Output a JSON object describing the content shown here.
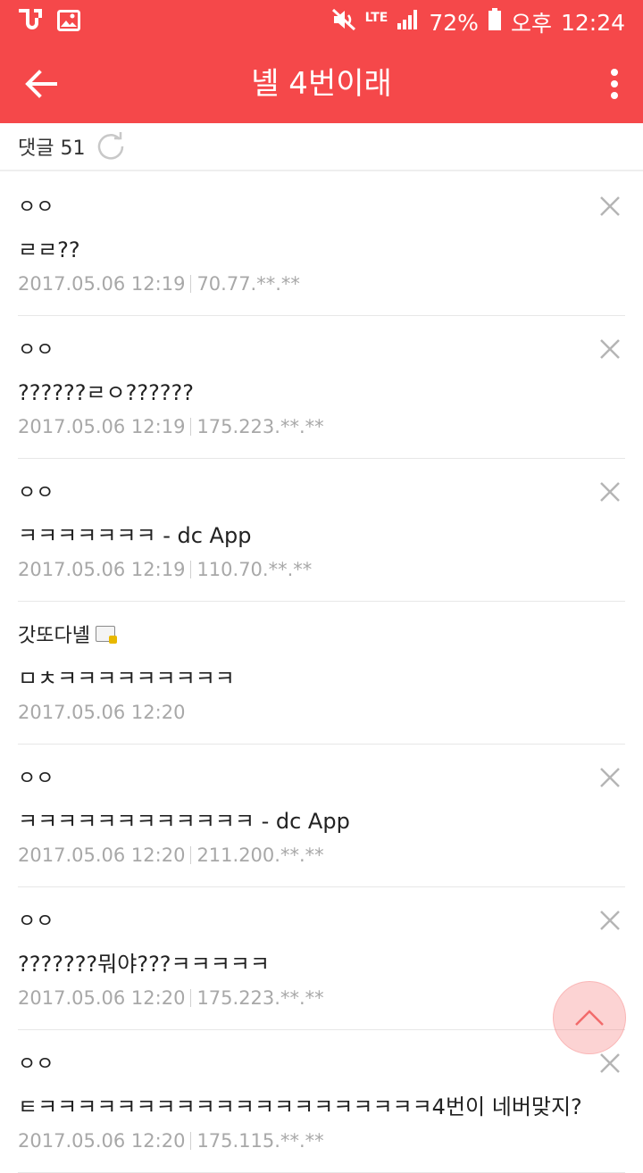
{
  "status_bar": {
    "battery": "72%",
    "ampm": "오후",
    "time": "12:24",
    "network": "LTE"
  },
  "app_bar": {
    "title": "녤 4번이래"
  },
  "comment_header": {
    "label": "댓글 51"
  },
  "comments": [
    {
      "author": "ㅇㅇ",
      "text": "ㄹㄹ??",
      "date": "2017.05.06 12:19",
      "ip": "70.77.**.**",
      "deletable": true
    },
    {
      "author": "ㅇㅇ",
      "text": "??????ㄹㅇ??????",
      "date": "2017.05.06 12:19",
      "ip": "175.223.**.**",
      "deletable": true
    },
    {
      "author": "ㅇㅇ",
      "text": "ㅋㅋㅋㅋㅋㅋㅋ - dc App",
      "date": "2017.05.06 12:19",
      "ip": "110.70.**.**",
      "deletable": true
    },
    {
      "author": "갓또다녤",
      "text": "ㅁㅊㅋㅋㅋㅋㅋㅋㅋㅋㅋ",
      "date": "2017.05.06 12:20",
      "ip": "",
      "deletable": false
    },
    {
      "author": "ㅇㅇ",
      "text": "ㅋㅋㅋㅋㅋㅋㅋㅋㅋㅋㅋㅋ - dc App",
      "date": "2017.05.06 12:20",
      "ip": "211.200.**.**",
      "deletable": true
    },
    {
      "author": "ㅇㅇ",
      "text": "???????뭐야???ㅋㅋㅋㅋㅋ",
      "date": "2017.05.06 12:20",
      "ip": "175.223.**.**",
      "deletable": true
    },
    {
      "author": "ㅇㅇ",
      "text": "ㅌㅋㅋㅋㅋㅋㅋㅋㅋㅋㅋㅋㅋㅋㅋㅋㅋㅋㅋㅋㅋ4번이 네버맞지?",
      "date": "2017.05.06 12:20",
      "ip": "175.115.**.**",
      "deletable": true
    }
  ],
  "colors": {
    "primary": "#f5484a",
    "meta_text": "#a8a8a8",
    "divider": "#e7e7e7"
  },
  "icons": {
    "back": "arrow-left-icon",
    "menu": "more-vert-icon",
    "refresh": "refresh-icon",
    "close": "close-icon",
    "scroll_top": "chevron-up-icon"
  }
}
